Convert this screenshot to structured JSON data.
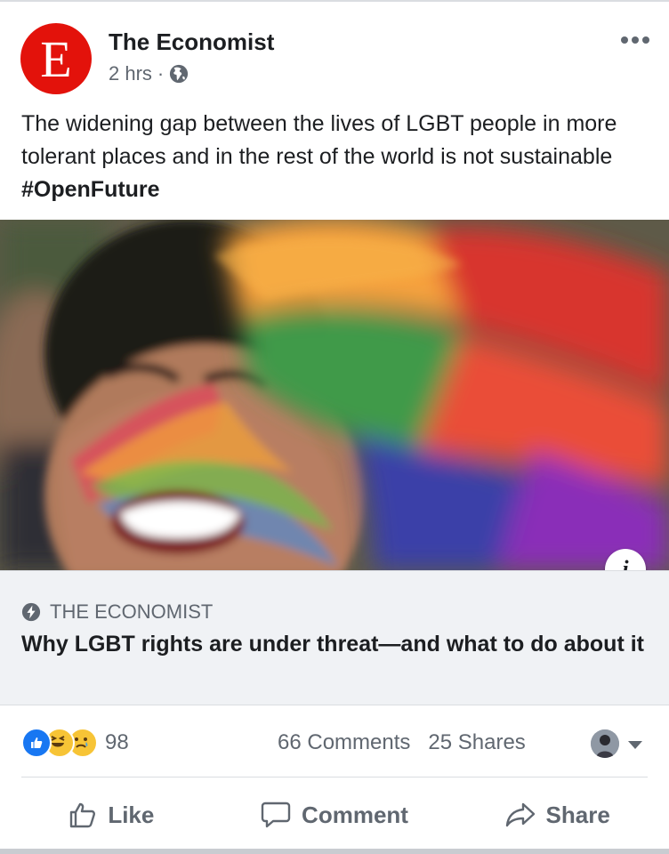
{
  "post": {
    "page_name": "The Economist",
    "avatar_letter": "E",
    "time": "2 hrs",
    "separator": "·",
    "text": "The widening gap between the lives of LGBT people in more tolerant places and in the rest of the world is not sustainable ",
    "hashtag": "#OpenFuture"
  },
  "link": {
    "source": "THE ECONOMIST",
    "title": "Why LGBT rights are under threat—and what to do about it",
    "info_label": "i"
  },
  "stats": {
    "reactions_count": "98",
    "comments": "66 Comments",
    "shares": "25 Shares"
  },
  "actions": {
    "like": "Like",
    "comment": "Comment",
    "share": "Share"
  },
  "colors": {
    "brand_red": "#e3120b",
    "fb_blue": "#1877f2",
    "secondary_text": "#606770"
  }
}
